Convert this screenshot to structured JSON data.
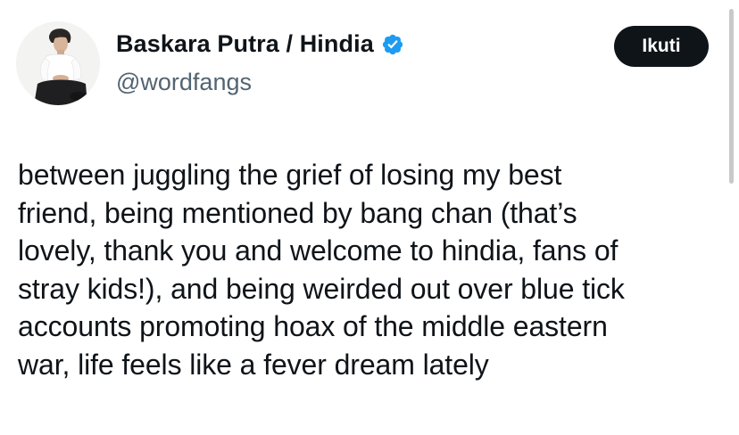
{
  "author": {
    "display_name": "Baskara Putra / Hindia",
    "handle": "@wordfangs",
    "verified": true,
    "verified_icon": "verified-badge-icon",
    "verified_color": "#1d9bf0"
  },
  "follow_button": {
    "label": "Ikuti"
  },
  "tweet": {
    "text": "between juggling the grief of losing my best\nfriend, being mentioned by bang chan (that’s\nlovely, thank you and welcome to hindia, fans of\nstray kids!), and being weirded out over blue tick\naccounts promoting hoax of the middle eastern\nwar, life feels like a fever dream lately"
  },
  "colors": {
    "text_primary": "#0f1419",
    "text_secondary": "#536471",
    "button_bg": "#0f1419",
    "button_text": "#ffffff"
  }
}
